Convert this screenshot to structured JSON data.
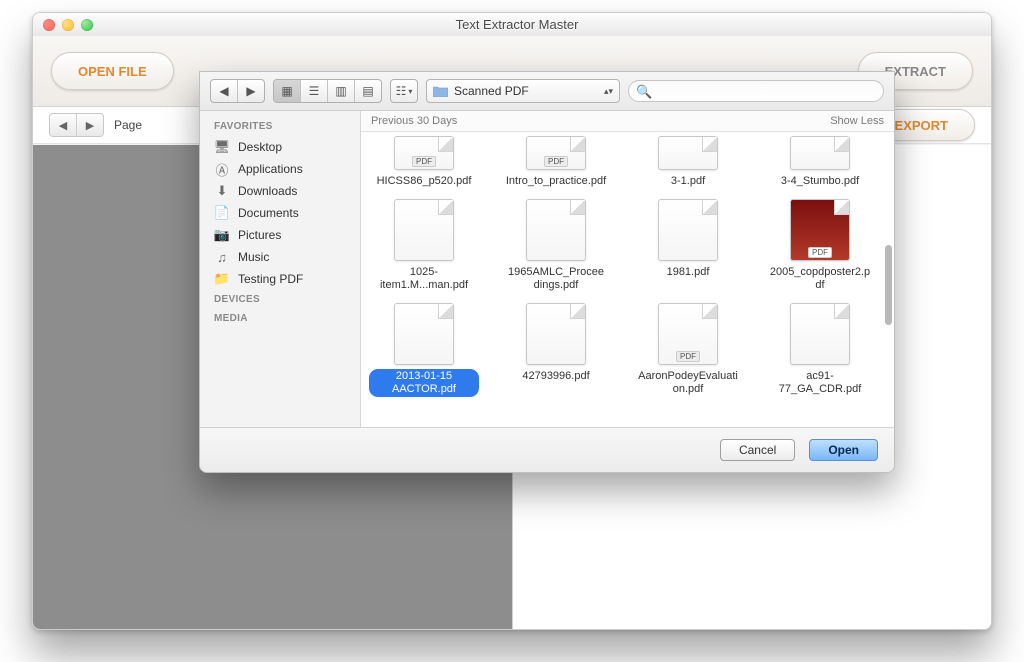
{
  "window": {
    "title": "Text Extractor Master"
  },
  "app_toolbar": {
    "open_file_label": "OPEN FILE",
    "extract_label": "EXTRACT",
    "export_label": "EXPORT"
  },
  "sub_toolbar": {
    "page_label": "Page"
  },
  "dialog": {
    "path_selected": "Scanned PDF",
    "search_placeholder": "",
    "section_header": "Previous 30 Days",
    "show_less_label": "Show Less",
    "sidebar": {
      "favorites_label": "FAVORITES",
      "devices_label": "DEVICES",
      "media_label": "MEDIA",
      "items": [
        {
          "label": "Desktop",
          "icon": "🖥"
        },
        {
          "label": "Applications",
          "icon": "Ⓐ"
        },
        {
          "label": "Downloads",
          "icon": "⬇"
        },
        {
          "label": "Documents",
          "icon": "📄"
        },
        {
          "label": "Pictures",
          "icon": "📷"
        },
        {
          "label": "Music",
          "icon": "♫"
        },
        {
          "label": "Testing PDF",
          "icon": "📁"
        }
      ]
    },
    "files": {
      "row0": [
        {
          "name": "HICSS86_p520.pdf",
          "selected": false,
          "half": true
        },
        {
          "name": "Intro_to_practice.pdf",
          "selected": false,
          "half": true
        },
        {
          "name": "3-1.pdf",
          "selected": false,
          "half": true
        },
        {
          "name": "3-4_Stumbo.pdf",
          "selected": false,
          "half": true
        }
      ],
      "row1": [
        {
          "name": "1025-item1.M...man.pdf",
          "selected": false
        },
        {
          "name": "1965AMLC_Proceedings.pdf",
          "selected": false
        },
        {
          "name": "1981.pdf",
          "selected": false
        },
        {
          "name": "2005_copdposter2.pdf",
          "selected": false,
          "colorful": true
        }
      ],
      "row2": [
        {
          "name": "2013-01-15 AACTOR.pdf",
          "selected": true
        },
        {
          "name": "42793996.pdf",
          "selected": false
        },
        {
          "name": "AaronPodeyEvaluation.pdf",
          "selected": false
        },
        {
          "name": "ac91-77_GA_CDR.pdf",
          "selected": false
        }
      ]
    },
    "footer": {
      "cancel_label": "Cancel",
      "open_label": "Open"
    }
  }
}
